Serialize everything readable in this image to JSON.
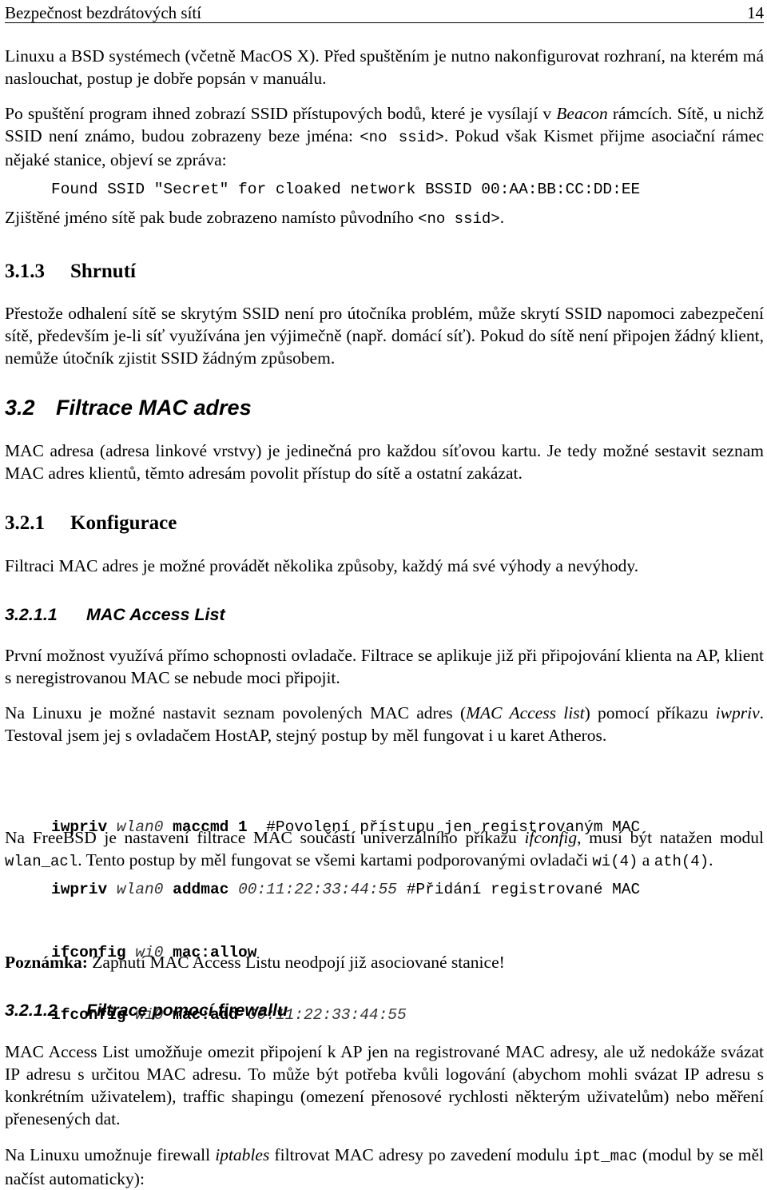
{
  "header": {
    "title": "Bezpečnost bezdrátových sítí",
    "page_number": "14"
  },
  "blocks": {
    "p1": "Linuxu a BSD systémech (včetně MacOS X). Před spuštěním je nutno nakonfigurovat rozhraní, na kterém má naslouchat, postup je dobře popsán v manuálu.",
    "p2": {
      "t1": "Po spuštění program ihned zobrazí SSID přístupových bodů, které je vysílají v ",
      "t2": "Beacon",
      "t3": " rámcích. Sítě, u nichž SSID není známo, budou zobrazeny beze jména: ",
      "t4": "<no ssid>",
      "t5": ". Pokud však Kismet přijme asociační rámec nějaké stanice, objeví se zpráva:"
    },
    "code1": "Found SSID \"Secret\" for cloaked network BSSID 00:AA:BB:CC:DD:EE",
    "p3": {
      "t1": "Zjištěné jméno sítě pak bude zobrazeno namísto původního ",
      "t2": "<no ssid>",
      "t3": "."
    },
    "h_313": {
      "num": "3.1.3",
      "title": "Shrnutí"
    },
    "p4": "Přestože odhalení sítě se skrytým SSID není pro útočníka problém, může skrytí SSID napomoci zabezpečení sítě, především je-li síť využívána jen výjimečně (např. domácí síť). Pokud do sítě není připojen žádný klient, nemůže útočník zjistit SSID žádným způsobem.",
    "h_32": {
      "num": "3.2",
      "title": "Filtrace MAC adres"
    },
    "p5": "MAC adresa (adresa linkové vrstvy) je jedinečná pro každou síťovou kartu. Je tedy možné sestavit seznam MAC adres klientů, těmto adresám povolit přístup do sítě a ostatní zakázat.",
    "h_321": {
      "num": "3.2.1",
      "title": "Konfigurace"
    },
    "p6": "Filtraci MAC adres je možné provádět několika způsoby, každý má své výhody a nevýhody.",
    "h_3211": {
      "num": "3.2.1.1",
      "title": "MAC Access List"
    },
    "p7": "První možnost využívá přímo schopnosti ovladače. Filtrace se aplikuje již při připojování klienta na AP, klient s neregistrovanou MAC se nebude moci připojit.",
    "p8": {
      "t1": "Na Linuxu je možné nastavit seznam povolených MAC adres (",
      "t2": "MAC Access list",
      "t3": ") pomocí příkazu ",
      "t4": "iwpriv",
      "t5": ". Testoval jsem jej s ovladačem HostAP, stejný postup by měl fungovat i u karet Atheros."
    },
    "code2": [
      {
        "cmd": "iwpriv",
        "iface": "wlan0",
        "op": "maccmd 1",
        "arg": "",
        "comment": "  #Povolení přístupu jen registrovaným MAC"
      },
      {
        "cmd": "iwpriv",
        "iface": "wlan0",
        "op": "addmac",
        "arg": "00:11:22:33:44:55",
        "comment": " #Přidání registrované MAC"
      }
    ],
    "p9": {
      "t1": "Na FreeBSD je nastavení filtrace MAC součástí univerzálního příkazu ",
      "t2": "ifconfig",
      "t3": ", musí být natažen modul ",
      "t4": "wlan_acl",
      "t5": ". Tento postup by měl fungovat se všemi kartami podporovanými ovladači ",
      "t6": "wi(4)",
      "t7": " a ",
      "t8": "ath(4)",
      "t9": "."
    },
    "code3": [
      {
        "cmd": "ifconfig",
        "iface": "wi0",
        "op": "mac:allow",
        "arg": ""
      },
      {
        "cmd": "ifconfig",
        "iface": "wi0",
        "op": "mac:add",
        "arg": "00:11:22:33:44:55"
      }
    ],
    "note": {
      "label": "Poznámka:",
      "text": " Zapnutí MAC Access Listu neodpojí již asociované stanice!"
    },
    "h_3212": {
      "num": "3.2.1.2",
      "title": "Filtrace pomocí firewallu"
    },
    "p10": "MAC Access List umožňuje omezit připojení k AP jen na registrované MAC adresy, ale už nedokáže svázat IP adresu s určitou MAC adresu. To může být potřeba kvůli logování (abychom mohli svázat IP adresu s konkrétním uživatelem), traffic shapingu (omezení přenosové rychlosti některým uživatelům) nebo měření přenesených dat.",
    "p11": {
      "t1": "Na Linuxu umožnuje firewall ",
      "t2": "iptables",
      "t3": " filtrovat MAC adresy po zavedení modulu ",
      "t4": "ipt_mac",
      "t5": " (modul by se měl načíst automaticky):"
    }
  }
}
